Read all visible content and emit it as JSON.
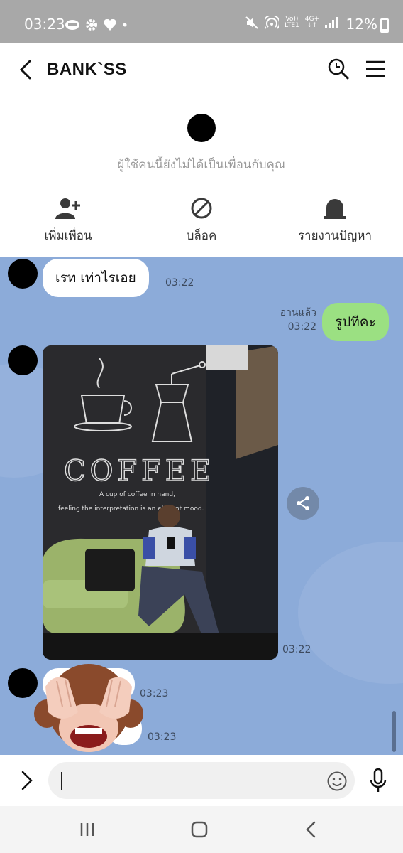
{
  "status_bar": {
    "time": "03:23",
    "network_label": "Vo))",
    "network_sub": "LTE1",
    "data_label": "4G+",
    "battery": "12%"
  },
  "header": {
    "title": "BANK`SS"
  },
  "profile": {
    "not_friend_text": "ผู้ใช้คนนี้ยังไม่ได้เป็นเพื่อนกับคุณ",
    "actions": [
      {
        "label": "เพิ่มเพื่อน",
        "icon": "add-friend-icon"
      },
      {
        "label": "บล็อค",
        "icon": "block-icon"
      },
      {
        "label": "รายงานปัญหา",
        "icon": "report-icon"
      }
    ]
  },
  "chat": {
    "messages": [
      {
        "type": "text",
        "direction": "in",
        "text": "เรท เท่าไรเอย",
        "time": "03:22"
      },
      {
        "type": "text",
        "direction": "out",
        "text": "รูปทีคะ",
        "time": "03:22",
        "read": "อ่านแล้ว"
      },
      {
        "type": "image",
        "direction": "in",
        "time": "03:22",
        "caption_line1": "COFFEE",
        "caption_line2": "A cup of coffee in hand,",
        "caption_line3": "feeling the interpretation is an elegant mood."
      },
      {
        "type": "sticker",
        "direction": "in",
        "time": "03:23",
        "icon": "monkey-covering-eyes-sticker"
      },
      {
        "type": "sticker",
        "direction": "in",
        "time": "03:23"
      }
    ]
  },
  "input": {
    "placeholder": ""
  },
  "colors": {
    "chat_bg": "#8cabd9",
    "outgoing_bubble": "#9be082",
    "incoming_bubble": "#ffffff",
    "status_bar": "#a8a8a8"
  }
}
